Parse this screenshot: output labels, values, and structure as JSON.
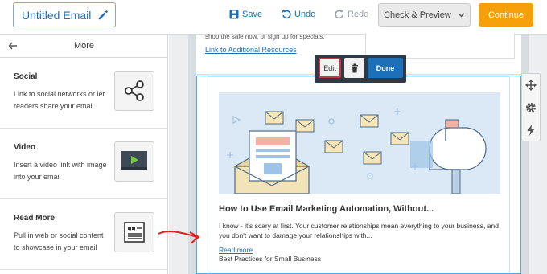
{
  "header": {
    "title": "Untitled Email",
    "save": "Save",
    "undo": "Undo",
    "redo": "Redo",
    "check_preview": "Check & Preview",
    "continue": "Continue"
  },
  "sidebar": {
    "title": "More",
    "items": [
      {
        "title": "Social",
        "desc": "Link to social networks or let readers share your email",
        "icon": "share-icon"
      },
      {
        "title": "Video",
        "desc": "Insert a video link with image into your email",
        "icon": "video-player-icon"
      },
      {
        "title": "Read More",
        "desc": "Pull in web or social content to showcase in your email",
        "icon": "article-quote-icon"
      }
    ]
  },
  "canvas": {
    "cut_text": "shop the sale now, or sign up for specials.",
    "resources_link": "Link to Additional Resources",
    "toolbar": {
      "edit": "Edit",
      "done": "Done"
    },
    "post": {
      "title": "How to Use Email Marketing Automation, Without...",
      "desc": "I know - it's scary at first. Your customer relationships mean everything to your business, and you don't want to damage your relationships with...",
      "read_more": "Read more",
      "subtitle": "Best Practices for Small Business"
    }
  },
  "colors": {
    "accent": "#1d6fb8",
    "continue": "#f5a00a",
    "selection": "#5aa6df",
    "annotation": "#e02020"
  }
}
